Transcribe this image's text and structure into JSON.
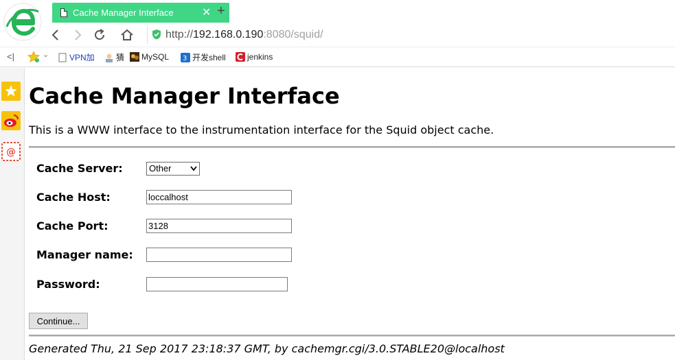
{
  "browser": {
    "tab": {
      "title": "Cache Manager Interface"
    },
    "address": {
      "protocol": "http://",
      "host": "192.168.0.190",
      "port": ":8080",
      "path": "/squid/"
    },
    "bookmarks": [
      {
        "label": "VPN加",
        "icon": "document-icon"
      },
      {
        "label": "猜",
        "icon": "person-icon"
      },
      {
        "label": "MySQL",
        "icon": "mysql-icon"
      },
      {
        "label": "开发shell",
        "icon": "shell-icon"
      },
      {
        "label": "jenkins",
        "icon": "jenkins-icon"
      }
    ],
    "colors": {
      "tab_accent": "#3fd686",
      "brand_blue": "#2a6de0",
      "brand_green": "#27b358"
    }
  },
  "page": {
    "title": "Cache Manager Interface",
    "intro": "This is a WWW interface to the instrumentation interface for the Squid object cache.",
    "form": {
      "server_label": "Cache Server:",
      "server_selected": "Other",
      "host_label": "Cache Host:",
      "host_value": "loccalhost",
      "port_label": "Cache Port:",
      "port_value": "3128",
      "manager_label": "Manager name:",
      "manager_value": "",
      "password_label": "Password:",
      "password_value": "",
      "submit_label": "Continue..."
    },
    "footer": "Generated Thu, 21 Sep 2017 23:18:37 GMT, by cachemgr.cgi/3.0.STABLE20@localhost"
  }
}
